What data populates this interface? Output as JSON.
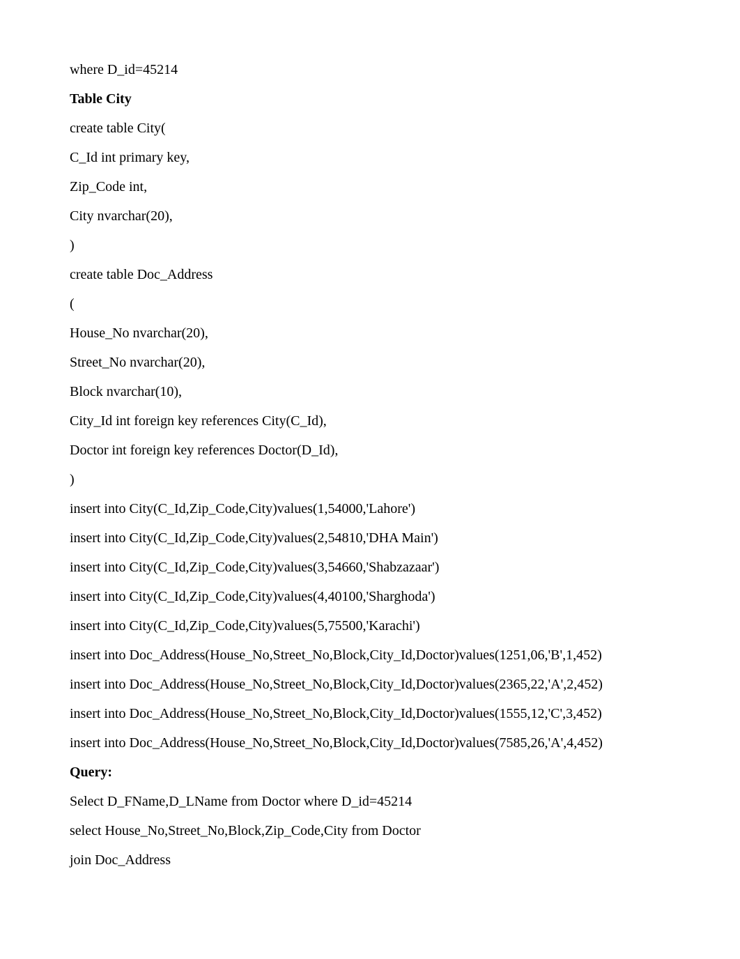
{
  "lines": [
    {
      "text": "where D_id=45214",
      "bold": false
    },
    {
      "text": "Table City",
      "bold": true
    },
    {
      "text": "create table City(",
      "bold": false
    },
    {
      "text": "C_Id int primary key,",
      "bold": false
    },
    {
      "text": "Zip_Code int,",
      "bold": false
    },
    {
      "text": "City nvarchar(20),",
      "bold": false
    },
    {
      "text": ")",
      "bold": false
    },
    {
      "text": "create table Doc_Address",
      "bold": false
    },
    {
      "text": "(",
      "bold": false
    },
    {
      "text": "House_No nvarchar(20),",
      "bold": false
    },
    {
      "text": "Street_No nvarchar(20),",
      "bold": false
    },
    {
      "text": "Block nvarchar(10),",
      "bold": false
    },
    {
      "text": "City_Id int foreign key references City(C_Id),",
      "bold": false
    },
    {
      "text": "Doctor int foreign key references Doctor(D_Id),",
      "bold": false
    },
    {
      "text": ")",
      "bold": false
    },
    {
      "text": "insert into City(C_Id,Zip_Code,City)values(1,54000,'Lahore')",
      "bold": false
    },
    {
      "text": "insert into City(C_Id,Zip_Code,City)values(2,54810,'DHA Main')",
      "bold": false
    },
    {
      "text": "insert into City(C_Id,Zip_Code,City)values(3,54660,'Shabzazaar')",
      "bold": false
    },
    {
      "text": "insert into City(C_Id,Zip_Code,City)values(4,40100,'Sharghoda')",
      "bold": false
    },
    {
      "text": "insert into City(C_Id,Zip_Code,City)values(5,75500,'Karachi')",
      "bold": false
    },
    {
      "text": "insert into Doc_Address(House_No,Street_No,Block,City_Id,Doctor)values(1251,06,'B',1,452)",
      "bold": false
    },
    {
      "text": "insert into Doc_Address(House_No,Street_No,Block,City_Id,Doctor)values(2365,22,'A',2,452)",
      "bold": false
    },
    {
      "text": "insert into Doc_Address(House_No,Street_No,Block,City_Id,Doctor)values(1555,12,'C',3,452)",
      "bold": false
    },
    {
      "text": "insert into Doc_Address(House_No,Street_No,Block,City_Id,Doctor)values(7585,26,'A',4,452)",
      "bold": false
    },
    {
      "text": "Query:",
      "bold": true
    },
    {
      "text": "Select D_FName,D_LName from Doctor where D_id=45214",
      "bold": false
    },
    {
      "text": "select House_No,Street_No,Block,Zip_Code,City from Doctor",
      "bold": false
    },
    {
      "text": "join Doc_Address",
      "bold": false
    }
  ]
}
